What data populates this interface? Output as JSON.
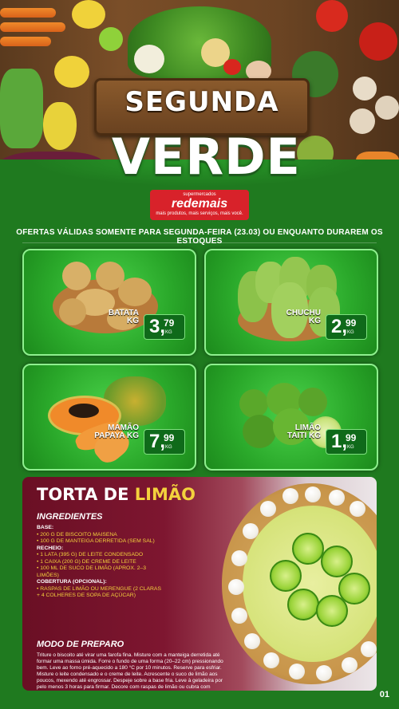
{
  "header": {
    "title_top": "SEGUNDA",
    "title_bottom": "VERDE",
    "logo": {
      "top": "supermercados",
      "name": "redemais",
      "tagline": "mais produtos, mais serviços, mais você."
    }
  },
  "notice": "OFERTAS VÁLIDAS SOMENTE PARA SEGUNDA-FEIRA (23.03) OU ENQUANTO DURAREM OS ESTOQUES",
  "products": [
    {
      "name_line1": "BATATA",
      "name_line2": "KG",
      "price_int": "3,",
      "price_dec": "79",
      "unit": "KG"
    },
    {
      "name_line1": "CHUCHU",
      "name_line2": "KG",
      "price_int": "2,",
      "price_dec": "99",
      "unit": "KG"
    },
    {
      "name_line1": "MAMÃO",
      "name_line2": "PAPAYA KG",
      "price_int": "7,",
      "price_dec": "99",
      "unit": "KG"
    },
    {
      "name_line1": "LIMÃO",
      "name_line2": "TAITI KG",
      "price_int": "1,",
      "price_dec": "99",
      "unit": "KG"
    }
  ],
  "recipe": {
    "title_main": "TORTA DE ",
    "title_accent": "LIMÃO",
    "ingredients_heading": "INGREDIENTES",
    "base_heading": "BASE:",
    "base_items": [
      "• 200 G DE BISCOITO MAISENA",
      "• 100 G DE MANTEIGA DERRETIDA (SEM SAL)"
    ],
    "filling_heading": "RECHEIO:",
    "filling_items": [
      "• 1 LATA (395 G) DE LEITE CONDENSADO",
      "• 1 CAIXA (200 G) DE CREME DE LEITE",
      "• 100 ML DE SUCO DE LIMÃO (APROX. 2–3 LIMÕES)"
    ],
    "topping_heading": "COBERTURA (OPCIONAL):",
    "topping_items": [
      "• RASPAS DE LIMÃO OU MERENGUE (2 CLARAS + 4 COLHERES DE SOPA DE AÇÚCAR)"
    ],
    "method_heading": "MODO DE PREPARO",
    "method_text": "Triture o biscoito até virar uma farofa fina. Misture com a manteiga derretida até formar uma massa úmida. Forre o fundo de uma forma (20–22 cm) pressionando bem. Leve ao forno pré-aquecido a 180 °C por 10 minutos. Reserve para esfriar. Misture o leite condensado e o creme de leite. Acrescente o suco de limão aos poucos, mexendo até engrossar. Despeje sobre a base fria. Leve à geladeira por pelo menos 3 horas para firmar. Decore com raspas de limão ou cubra com merengue e doure com maçarico ou forno."
  },
  "page_number": "01"
}
